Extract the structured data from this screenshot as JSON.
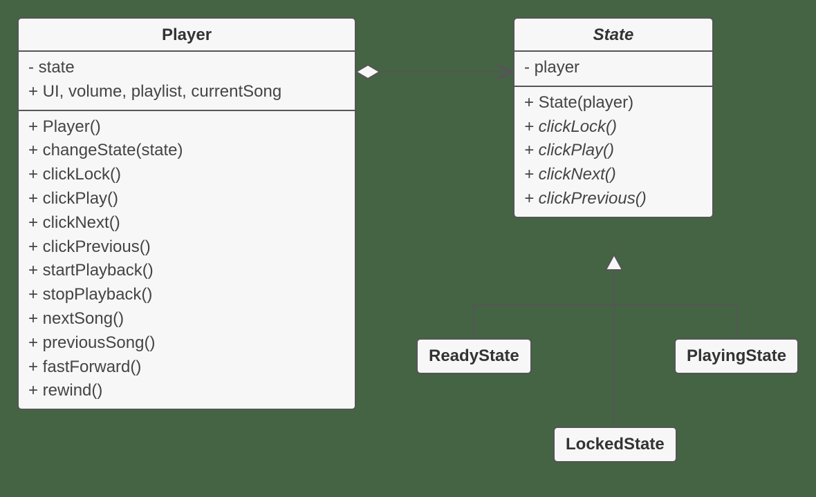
{
  "player": {
    "title": "Player",
    "attributes": [
      "- state",
      "+ UI, volume, playlist, currentSong"
    ],
    "methods": [
      "+ Player()",
      "+ changeState(state)",
      "+ clickLock()",
      "+ clickPlay()",
      "+ clickNext()",
      "+ clickPrevious()",
      "+ startPlayback()",
      "+ stopPlayback()",
      "+ nextSong()",
      "+ previousSong()",
      "+ fastForward()",
      "+ rewind()"
    ]
  },
  "state": {
    "title": "State",
    "attributes": [
      "- player"
    ],
    "methods": [
      {
        "text": "+ State(player)",
        "italic": false
      },
      {
        "text": "+ clickLock()",
        "italic": true
      },
      {
        "text": "+ clickPlay()",
        "italic": true
      },
      {
        "text": "+ clickNext()",
        "italic": true
      },
      {
        "text": "+ clickPrevious()",
        "italic": true
      }
    ]
  },
  "subclasses": {
    "ready": "ReadyState",
    "locked": "LockedState",
    "playing": "PlayingState"
  }
}
